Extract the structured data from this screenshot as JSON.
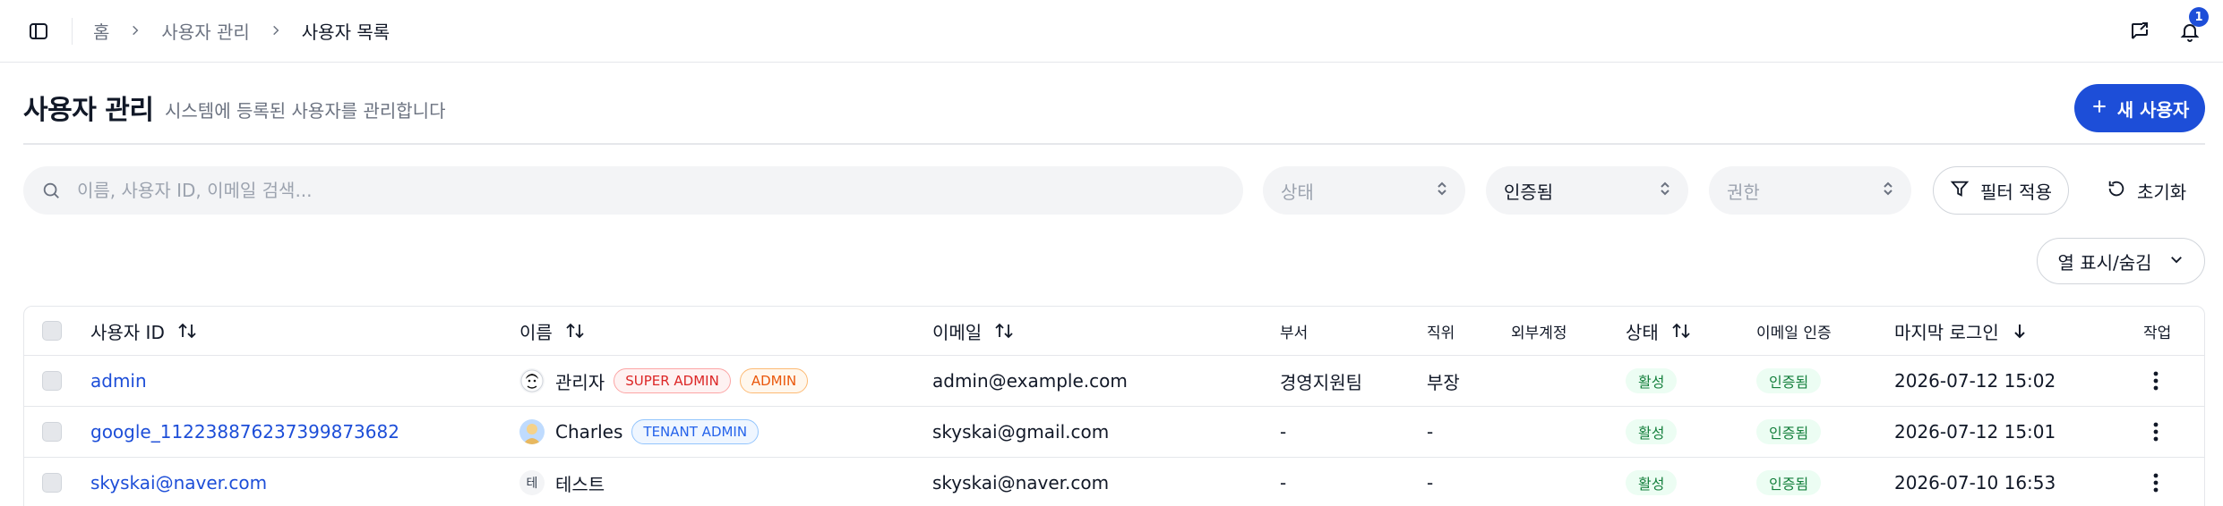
{
  "breadcrumb": {
    "home": "홈",
    "section": "사용자 관리",
    "current": "사용자 목록"
  },
  "notifications": {
    "count": "1"
  },
  "header": {
    "title": "사용자 관리",
    "subtitle": "시스템에 등록된 사용자를 관리합니다",
    "new_user_label": "새 사용자"
  },
  "filters": {
    "search_placeholder": "이름, 사용자 ID, 이메일 검색...",
    "status_placeholder": "상태",
    "verification_value": "인증됨",
    "role_placeholder": "권한",
    "apply_label": "필터 적용",
    "reset_label": "초기화",
    "columns_label": "열 표시/숨김"
  },
  "table": {
    "columns": {
      "user_id": "사용자 ID",
      "name": "이름",
      "email": "이메일",
      "department": "부서",
      "position": "직위",
      "external": "외부계정",
      "status": "상태",
      "email_verified": "이메일 인증",
      "last_login": "마지막 로그인",
      "actions": "작업"
    },
    "rows": [
      {
        "user_id": "admin",
        "avatar": "",
        "name": "관리자",
        "tags": [
          "SUPER ADMIN",
          "ADMIN"
        ],
        "email": "admin@example.com",
        "department": "경영지원팀",
        "position": "부장",
        "external": "",
        "status": "활성",
        "email_verified": "인증됨",
        "last_login": "2026-07-12 15:02"
      },
      {
        "user_id": "google_112238876237399873682",
        "avatar": "",
        "name": "Charles",
        "tags": [
          "TENANT ADMIN"
        ],
        "email": "skyskai@gmail.com",
        "department": "-",
        "position": "-",
        "external": "",
        "status": "활성",
        "email_verified": "인증됨",
        "last_login": "2026-07-12 15:01"
      },
      {
        "user_id": "skyskai@naver.com",
        "avatar": "테",
        "name": "테스트",
        "tags": [],
        "email": "skyskai@naver.com",
        "department": "-",
        "position": "-",
        "external": "",
        "status": "활성",
        "email_verified": "인증됨",
        "last_login": "2026-07-10 16:53"
      }
    ]
  },
  "colors": {
    "primary": "#1d4ed8",
    "success_bg": "#ecfdf3",
    "success_text": "#15803d",
    "super_admin": "#dc2626",
    "admin": "#ea580c",
    "tenant_admin": "#2563eb"
  }
}
